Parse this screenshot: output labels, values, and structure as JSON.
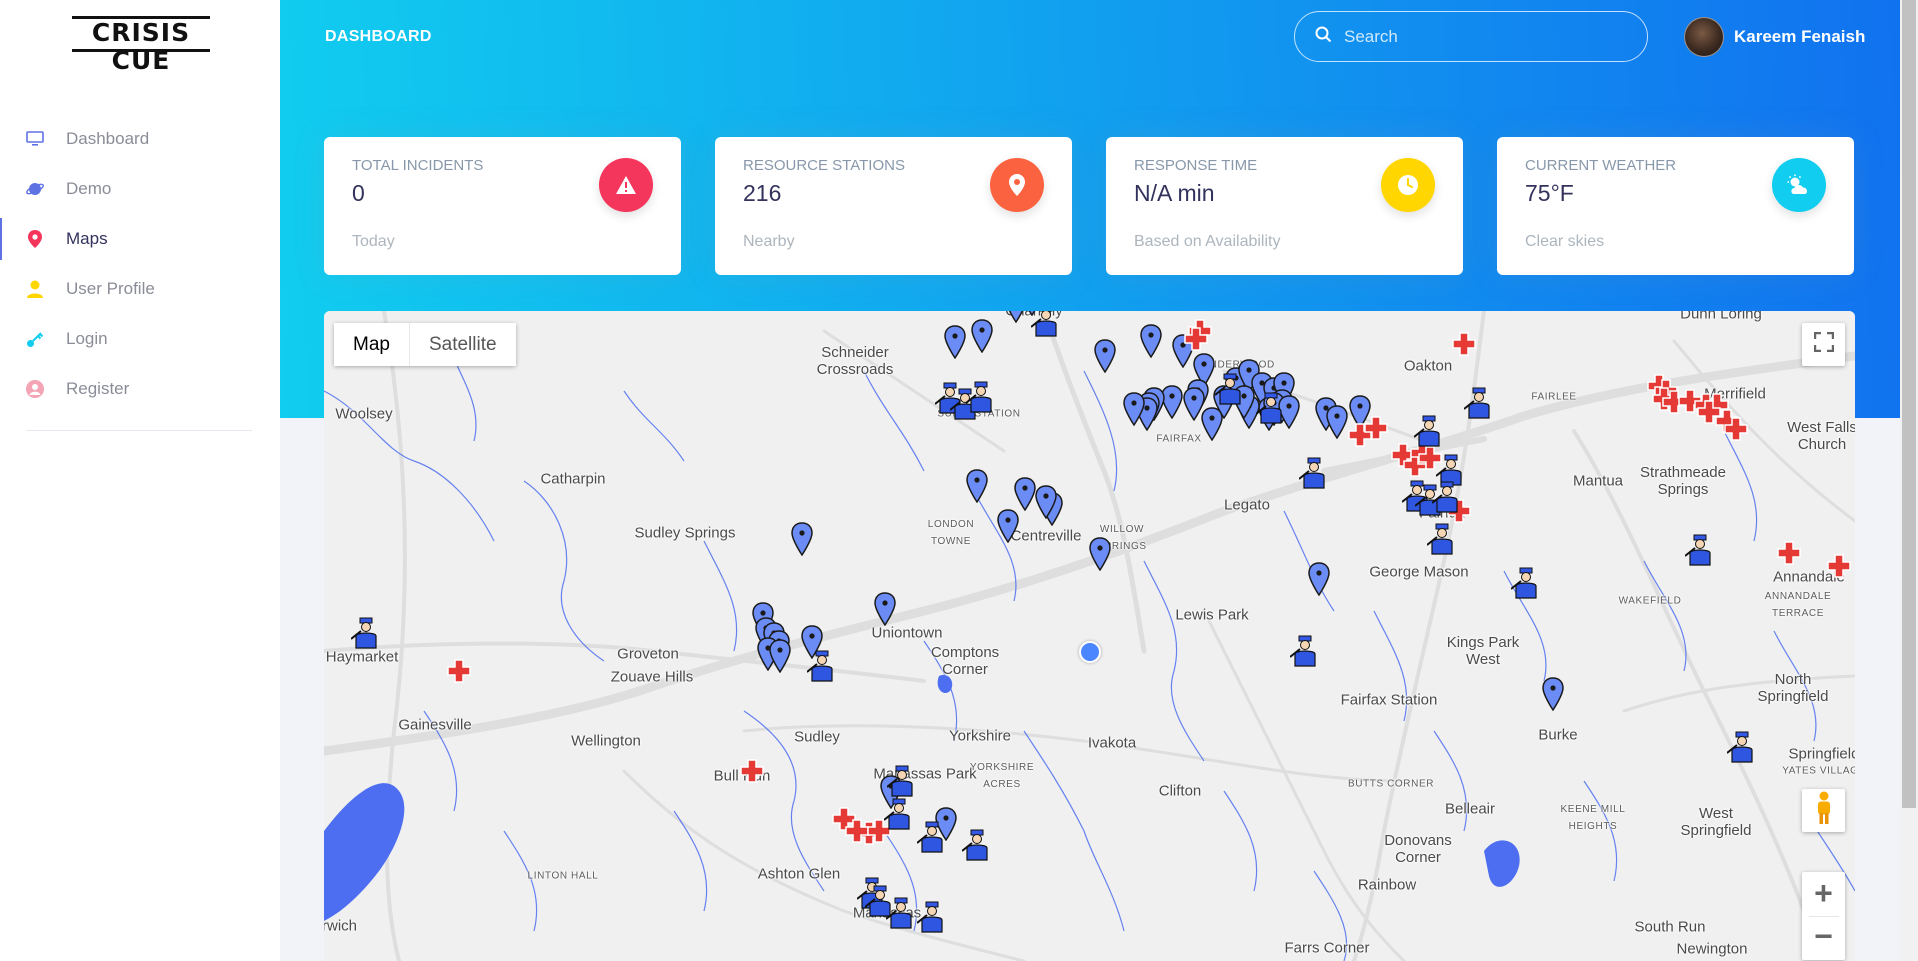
{
  "brand": {
    "logo_text": "CRISIS CUE"
  },
  "sidebar": {
    "items": [
      {
        "label": "Dashboard",
        "icon": "monitor-icon",
        "color": "#5e72e4"
      },
      {
        "label": "Demo",
        "icon": "planet-icon",
        "color": "#5e72e4"
      },
      {
        "label": "Maps",
        "icon": "pin-icon",
        "color": "#f5365c"
      },
      {
        "label": "User Profile",
        "icon": "user-icon",
        "color": "#ffd600"
      },
      {
        "label": "Login",
        "icon": "key-icon",
        "color": "#11cdef"
      },
      {
        "label": "Register",
        "icon": "circle-user-icon",
        "color": "#f3a4b5"
      }
    ],
    "active_index": 2
  },
  "header": {
    "title": "DASHBOARD",
    "search_placeholder": "Search",
    "user_name": "Kareem Fenaish"
  },
  "cards": [
    {
      "title": "TOTAL INCIDENTS",
      "value": "0",
      "sub": "Today",
      "icon": "warning-icon",
      "color": "#f5365c"
    },
    {
      "title": "RESOURCE STATIONS",
      "value": "216",
      "sub": "Nearby",
      "icon": "location-icon",
      "color": "#fb6340"
    },
    {
      "title": "RESPONSE TIME",
      "value": "N/A min",
      "sub": "Based on Availability",
      "icon": "clock-icon",
      "color": "#ffd600"
    },
    {
      "title": "CURRENT WEATHER",
      "value": "75°F",
      "sub": "Clear skies",
      "icon": "cloud-sun-icon",
      "color": "#11cdef"
    }
  ],
  "map": {
    "toggle": {
      "map": "Map",
      "satellite": "Satellite",
      "selected": "Map"
    },
    "zoom_in": "+",
    "zoom_out": "−",
    "places": [
      "Chantilly",
      "Schneider Crossroads",
      "SULLY STATION",
      "PENDERWOOD",
      "Oakton",
      "Dunn Loring",
      "Merrifield",
      "FAIRLEE",
      "West Falls Church",
      "Woolsey",
      "Catharpin",
      "Mantua",
      "Strathmeade Springs",
      "FAIRFAX",
      "Legato",
      "Sudley Springs",
      "LONDON TOWNE",
      "Centreville",
      "WILLOW SPRINGS",
      "Fairfax",
      "George Mason",
      "Annandale",
      "WAKEFIELD",
      "ANNANDALE TERRACE",
      "Lewis Park",
      "Haymarket",
      "Groveton",
      "Zouave Hills",
      "Uniontown",
      "Comptons Corner",
      "Kings Park West",
      "Fairfax Station",
      "North Springfield",
      "Gainesville",
      "Wellington",
      "Sudley",
      "Yorkshire",
      "Ivakota",
      "Burke",
      "Bull Run",
      "Manassas Park",
      "YORKSHIRE ACRES",
      "Clifton",
      "BUTTS CORNER",
      "KEENE MILL HEIGHTS",
      "Springfield",
      "YATES VILLAGE",
      "West Springfield",
      "Belleair",
      "Donovans Corner",
      "Ashton Glen",
      "LINTON HALL",
      "Rainbow",
      "South Run",
      "Manassas",
      "Farrs Corner",
      "Newington",
      "Norwich"
    ]
  }
}
